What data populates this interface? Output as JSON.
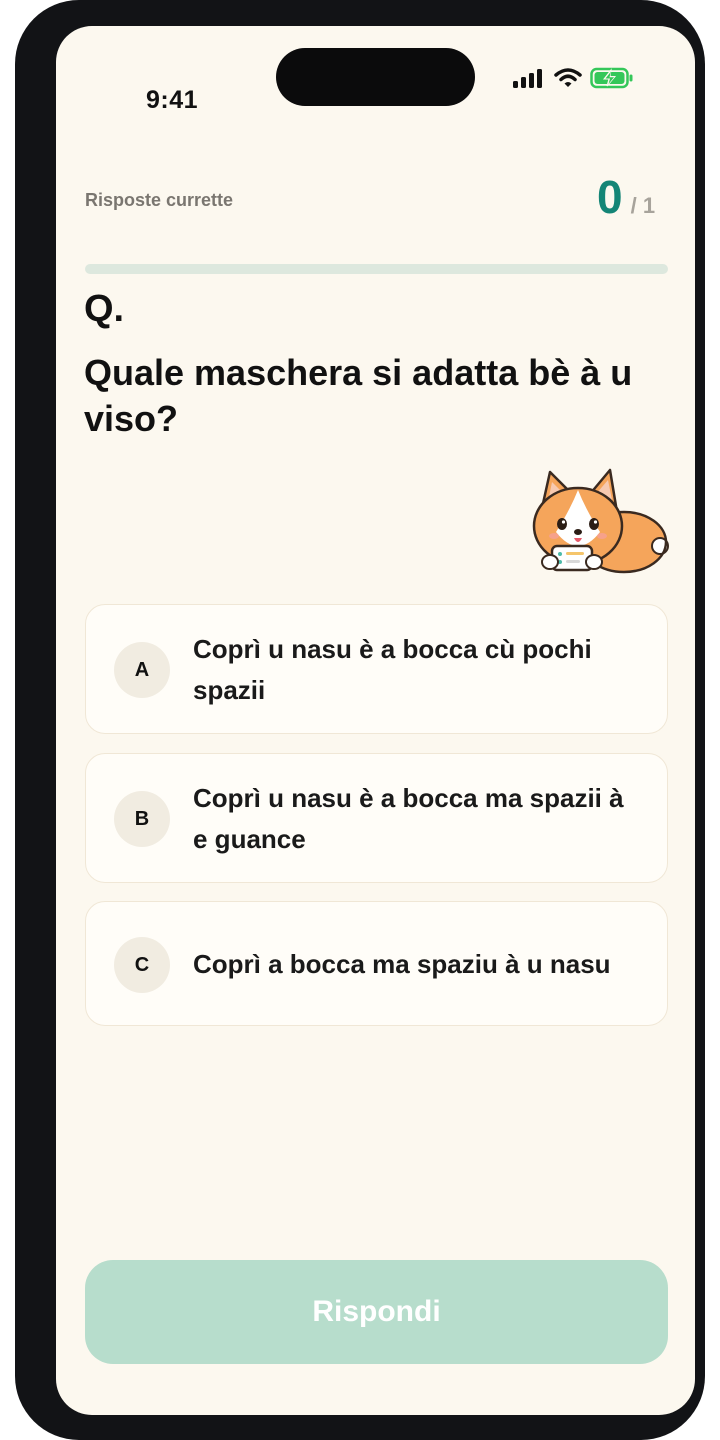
{
  "status_bar": {
    "time": "9:41",
    "icons": [
      "cellular-signal-icon",
      "wifi-icon",
      "battery-charging-icon"
    ],
    "battery_color": "#34c759"
  },
  "score": {
    "label": "Risposte currette",
    "correct": "0",
    "total": "/ 1",
    "accent": "#148576"
  },
  "progress": {
    "fraction": 0
  },
  "question": {
    "prefix": "Q.",
    "text": "Quale maschera si adatta bè à u viso?"
  },
  "mascot": {
    "icon": "corgi-mascot-icon"
  },
  "options": [
    {
      "letter": "A",
      "text": "Coprì u nasu è a bocca cù pochi spazii"
    },
    {
      "letter": "B",
      "text": "Coprì u nasu è a bocca ma spazii à e guance"
    },
    {
      "letter": "C",
      "text": "Coprì a bocca ma spaziu à u nasu"
    }
  ],
  "submit": {
    "label": "Rispondi",
    "color": "#b7ddcc"
  }
}
